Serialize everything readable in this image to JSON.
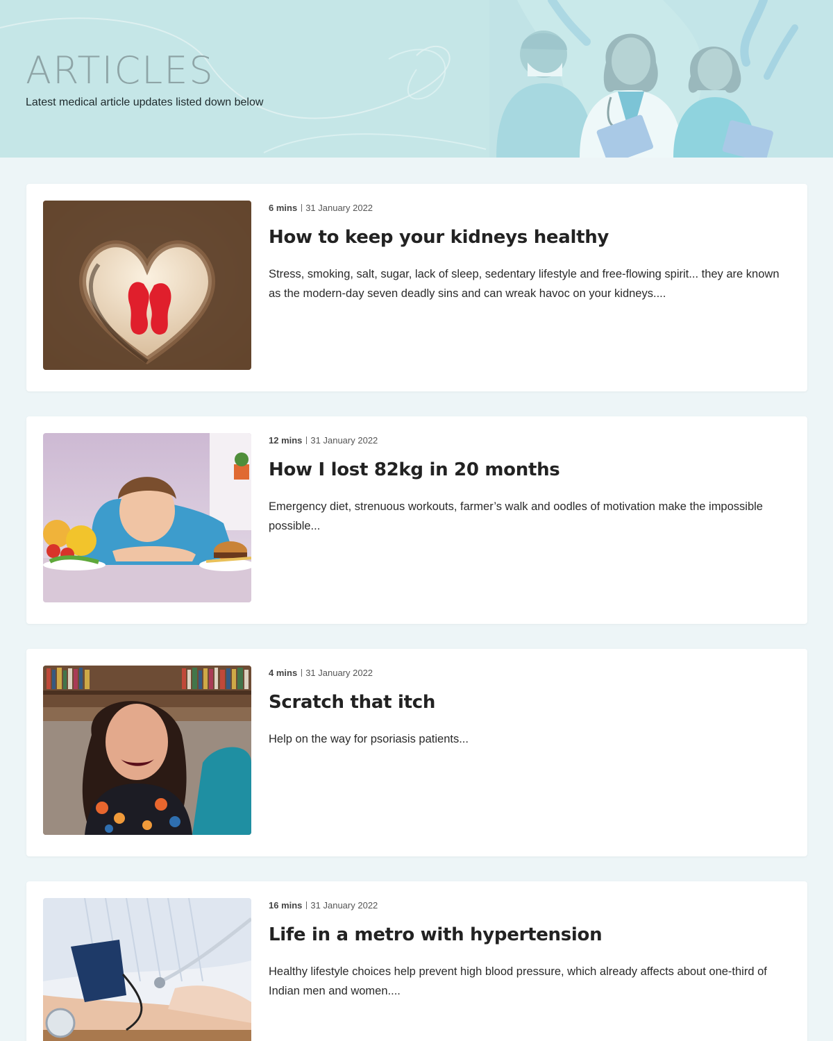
{
  "header": {
    "title": "ARTICLES",
    "subtitle": "Latest medical article updates listed down below",
    "background_color": "#c5e6e7",
    "illustration": "doctors-nurses-illustration"
  },
  "articles": [
    {
      "read_time": "6 mins",
      "date": "31 January 2022",
      "title": "How to keep your kidneys healthy",
      "excerpt": "Stress, smoking, salt, sugar, lack of sleep, sedentary lifestyle and free-flowing spirit... they are known as the modern-day seven deadly sins and can wreak havoc on your kidneys....",
      "image": "hands-heart-kidneys-image"
    },
    {
      "read_time": "12 mins",
      "date": "31 January 2022",
      "title": "How I lost 82kg in 20 months",
      "excerpt": "Emergency diet, strenuous workouts, farmer’s walk and oodles of motivation make the impossible possible...",
      "image": "boy-with-vegetables-and-burger-image"
    },
    {
      "read_time": "4 mins",
      "date": "31 January 2022",
      "title": "Scratch that itch",
      "excerpt": "Help on the way for psoriasis patients...",
      "image": "smiling-woman-portrait-image"
    },
    {
      "read_time": "16 mins",
      "date": "31 January 2022",
      "title": "Life in a metro with hypertension",
      "excerpt": "Healthy lifestyle choices help prevent high blood pressure, which already affects about one-third of Indian men and women....",
      "image": "blood-pressure-measurement-image"
    }
  ]
}
